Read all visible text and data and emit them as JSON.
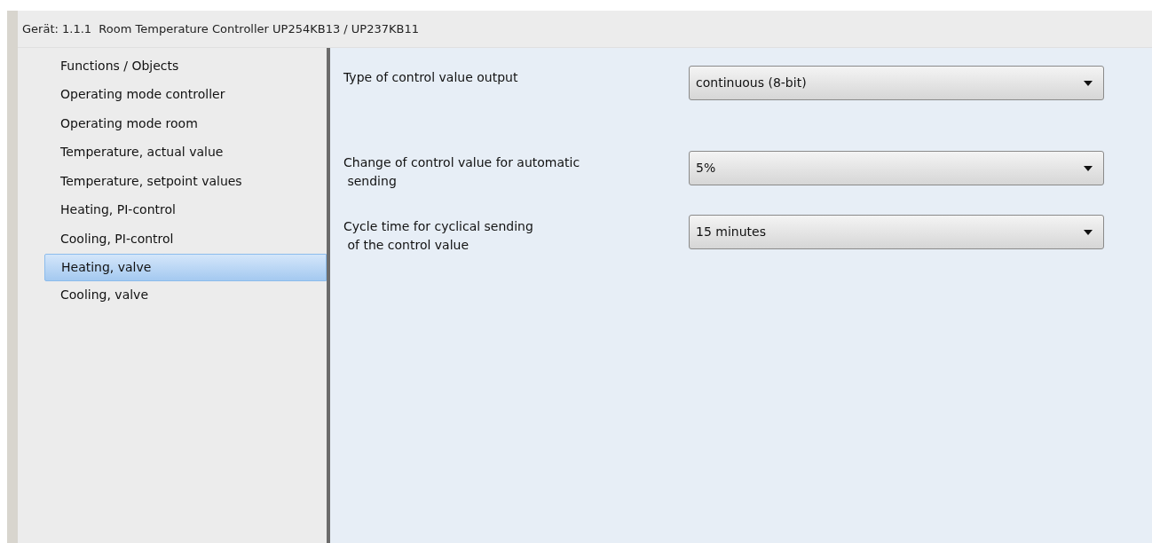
{
  "window": {
    "title": "Gerät: 1.1.1  Room Temperature Controller UP254KB13 / UP237KB11"
  },
  "sidebar": {
    "items": [
      {
        "label": "Functions / Objects",
        "selected": false
      },
      {
        "label": "Operating mode controller",
        "selected": false
      },
      {
        "label": "Operating mode room",
        "selected": false
      },
      {
        "label": "Temperature, actual value",
        "selected": false
      },
      {
        "label": "Temperature, setpoint values",
        "selected": false
      },
      {
        "label": "Heating, PI-control",
        "selected": false
      },
      {
        "label": "Cooling, PI-control",
        "selected": false
      },
      {
        "label": "Heating, valve",
        "selected": true
      },
      {
        "label": "Cooling, valve",
        "selected": false
      }
    ]
  },
  "parameters": [
    {
      "label": "Type of control value output",
      "value": "continuous (8-bit)"
    },
    {
      "label": "Change of control value for automatic\n sending",
      "value": "5%"
    },
    {
      "label": "Cycle time for cyclical sending\n of the control value",
      "value": "15 minutes"
    }
  ]
}
